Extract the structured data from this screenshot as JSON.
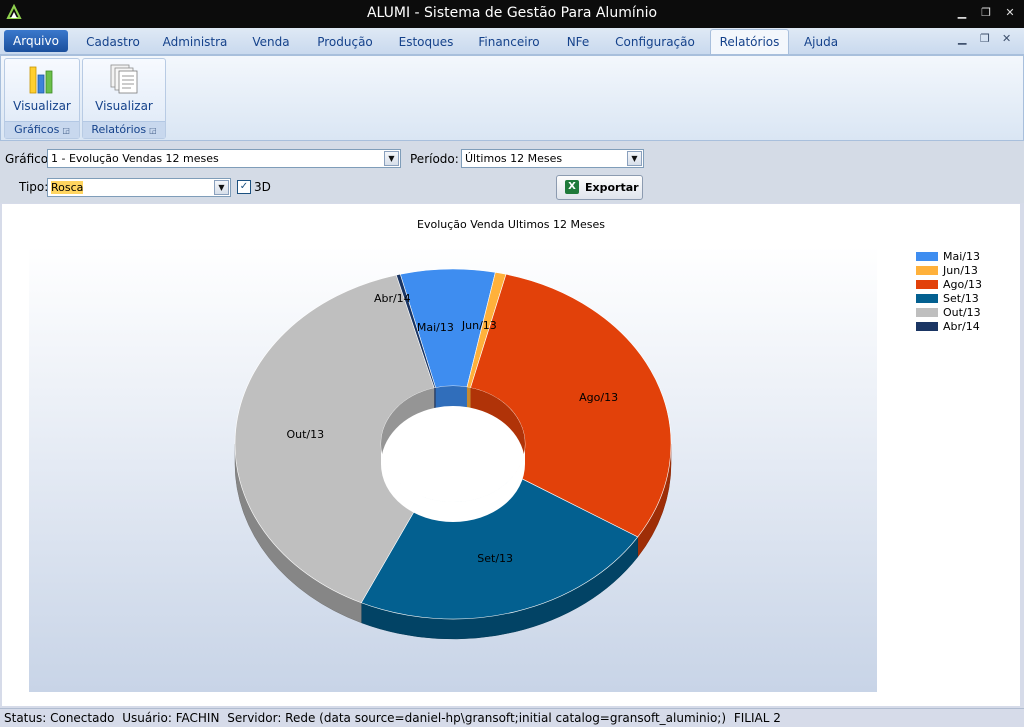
{
  "window": {
    "title": "ALUMI - Sistema de Gestão Para Alumínio"
  },
  "menu": {
    "arquivo": "Arquivo",
    "tabs": [
      {
        "label": "Cadastro"
      },
      {
        "label": "Administra"
      },
      {
        "label": "Venda"
      },
      {
        "label": "Produção"
      },
      {
        "label": "Estoques"
      },
      {
        "label": "Financeiro"
      },
      {
        "label": "NFe"
      },
      {
        "label": "Configuração"
      },
      {
        "label": "Relatórios",
        "active": true
      },
      {
        "label": "Ajuda"
      }
    ]
  },
  "ribbon": {
    "groups": [
      {
        "button": "Visualizar",
        "label": "Gráficos",
        "icon": "bar-chart-icon"
      },
      {
        "button": "Visualizar",
        "label": "Relatórios",
        "icon": "documents-icon"
      }
    ]
  },
  "filters": {
    "grafico_label": "Gráfico:",
    "grafico_value": "1 - Evolução Vendas 12 meses",
    "periodo_label": "Período:",
    "periodo_value": "Últimos 12 Meses",
    "tipo_label": "Tipo:",
    "tipo_value": "Rosca",
    "check_3d_label": "3D",
    "check_3d_checked": true,
    "export_label": "Exportar"
  },
  "chart_data": {
    "type": "pie",
    "variant": "doughnut-3d",
    "title": "Evolução Venda Ultimos 12 Meses",
    "legend_position": "right",
    "slices": [
      {
        "label": "Mai/13",
        "value": 7.0,
        "color": "#3e8df0"
      },
      {
        "label": "Jun/13",
        "value": 0.8,
        "color": "#ffb13b"
      },
      {
        "label": "Ago/13",
        "value": 30.0,
        "color": "#e2410a"
      },
      {
        "label": "Set/13",
        "value": 23.0,
        "color": "#036090"
      },
      {
        "label": "Out/13",
        "value": 38.9,
        "color": "#bfbfbf"
      },
      {
        "label": "Abr/14",
        "value": 0.3,
        "color": "#1a3563"
      }
    ]
  },
  "status": {
    "status": "Status: Conectado",
    "usuario": "Usuário: FACHIN",
    "servidor": "Servidor: Rede (data source=daniel-hp\\gransoft;initial catalog=gransoft_aluminio;)",
    "filial": "FILIAL 2"
  }
}
